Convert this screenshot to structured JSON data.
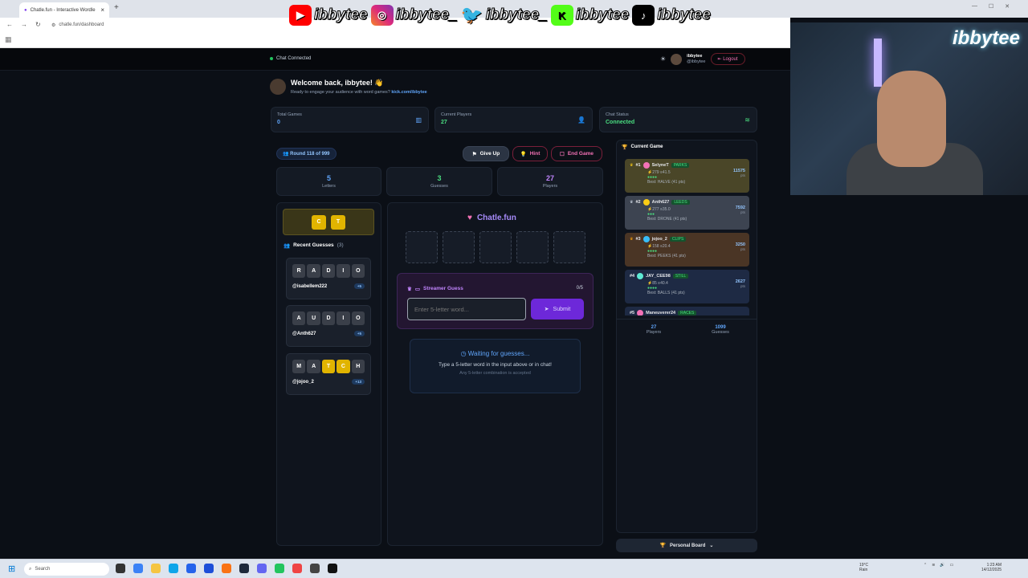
{
  "browser": {
    "tab_title": "Chatle.fun - Interactive Wordle",
    "url": "chatle.fun/dashboard"
  },
  "overlay": {
    "socials": [
      {
        "icon": "youtube-icon",
        "color": "#ff0000",
        "handle": "ibbytee"
      },
      {
        "icon": "instagram-icon",
        "color": "#d6249f",
        "handle": "ibbytee_"
      },
      {
        "icon": "twitter-icon",
        "color": "#1da1f2",
        "handle": "ibbytee_"
      },
      {
        "icon": "kick-icon",
        "color": "#53fc18",
        "handle": "ibbytee"
      },
      {
        "icon": "tiktok-icon",
        "color": "#000000",
        "handle": "ibbytee"
      }
    ],
    "webcam_logo": "ibbytee"
  },
  "nav": {
    "chat_status": "Chat Connected",
    "user_name": "ibbytee",
    "user_handle": "@ibbytee",
    "logout": "Logout"
  },
  "welcome": {
    "title": "Welcome back, ibbytee! 👋",
    "subtitle": "Ready to engage your audience with word games?",
    "link": "kick.com/ibbytee"
  },
  "stats": {
    "total_games_label": "Total Games",
    "total_games": "0",
    "current_players_label": "Current Players",
    "current_players": "27",
    "chat_status_label": "Chat Status",
    "chat_status": "Connected"
  },
  "game": {
    "round": "Round 118 of 999",
    "give_up": "Give Up",
    "hint": "Hint",
    "end_game": "End Game",
    "letters": "5",
    "letters_label": "Letters",
    "guesses": "3",
    "guesses_label": "Guesses",
    "players": "27",
    "players_label": "Players",
    "hint_tiles": [
      "C",
      "T"
    ],
    "recent_label": "Recent Guesses",
    "recent_count": "(3)",
    "recent": [
      {
        "letters": [
          "R",
          "A",
          "D",
          "I",
          "O"
        ],
        "yellow": [],
        "user": "@isabellem222",
        "points": "+5"
      },
      {
        "letters": [
          "A",
          "U",
          "D",
          "I",
          "O"
        ],
        "yellow": [],
        "user": "@Anth627",
        "points": "+5"
      },
      {
        "letters": [
          "M",
          "A",
          "T",
          "C",
          "H"
        ],
        "yellow": [
          2,
          3
        ],
        "user": "@jojoo_2",
        "points": "+13"
      }
    ],
    "brand": "Chatle.fun",
    "streamer_guess": "Streamer Guess",
    "streamer_count": "0/5",
    "input_placeholder": "Enter 5-letter word...",
    "submit": "Submit",
    "waiting_title": "Waiting for guesses...",
    "waiting_line1": "Type a 5-letter word in the input above or in chat!",
    "waiting_line2": "Any 5-letter combination is accepted"
  },
  "leaderboard": {
    "title": "Current Game",
    "entries": [
      {
        "rank": "#1",
        "name": "SelyneT",
        "tag": "PARKS",
        "sub": "⚡279 ≡41.5",
        "best": "Best: HALVE (41 pts)",
        "score": "11575",
        "pts": "pts",
        "bg": "#4a4628",
        "av": "#f472b6"
      },
      {
        "rank": "#2",
        "name": "Anth627",
        "tag": "LEEDS",
        "sub": "⚡277 ≡35.0",
        "best": "Best: DRONE (41 pts)",
        "score": "7592",
        "pts": "pts",
        "bg": "#3d4451",
        "av": "#facc15"
      },
      {
        "rank": "#3",
        "name": "jojoo_2",
        "tag": "CLIPS",
        "sub": "⚡158 ≡20.4",
        "best": "Best: PEEKS (41 pts)",
        "score": "3250",
        "pts": "pts",
        "bg": "#4a3525",
        "av": "#38bdf8"
      },
      {
        "rank": "#4",
        "name": "JAY_CEE98",
        "tag": "STILL",
        "sub": "⚡85 ≡40.4",
        "best": "Best: BALLS (41 pts)",
        "score": "2627",
        "pts": "pts",
        "bg": "#1e2a44",
        "av": "#5eead4"
      },
      {
        "rank": "#5",
        "name": "Maneuverer24",
        "tag": "RACES",
        "sub": "",
        "best": "",
        "score": "",
        "pts": "",
        "bg": "#1e2a44",
        "av": "#f472b6"
      }
    ],
    "players": "27",
    "players_label": "Players",
    "guesses": "1099",
    "guesses_label": "Guesses",
    "personal_board": "Personal Board"
  },
  "taskbar": {
    "search": "Search",
    "weather_temp": "19°C",
    "weather_desc": "Rain",
    "time": "1:23 AM",
    "date": "14/12/2025"
  }
}
